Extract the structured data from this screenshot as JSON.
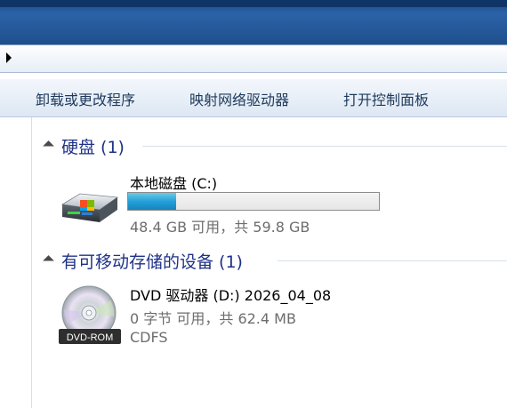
{
  "toolbar": {
    "uninstall": "卸载或更改程序",
    "map_drive": "映射网络驱动器",
    "control_panel": "打开控制面板"
  },
  "groups": {
    "hdd": {
      "title": "硬盘 (1)"
    },
    "removable": {
      "title": "有可移动存储的设备 (1)"
    }
  },
  "drives": {
    "c": {
      "name": "本地磁盘 (C:)",
      "space": "48.4 GB 可用，共 59.8 GB",
      "used_fraction": 0.19
    },
    "d": {
      "name": "DVD 驱动器 (D:) 2026_04_08",
      "space": "0 字节 可用，共 62.4 MB",
      "fs": "CDFS",
      "badge": "DVD-ROM"
    }
  },
  "colors": {
    "group_title": "#1e3287",
    "usage_bar": "#26a0d9",
    "titlebar": "#2b63a8"
  }
}
